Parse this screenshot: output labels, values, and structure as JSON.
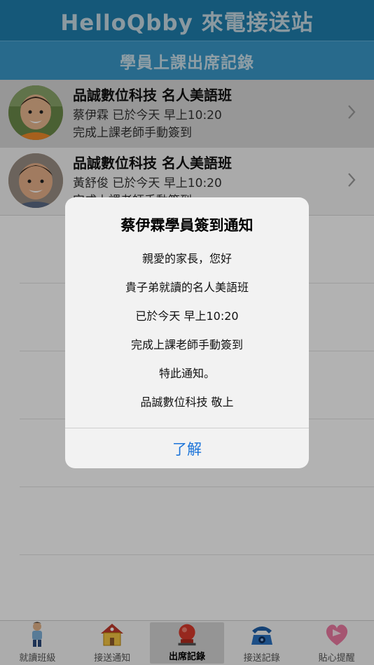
{
  "header": {
    "title": "HelloQbby 來電接送站"
  },
  "subheader": {
    "title": "學員上課出席記錄"
  },
  "records": [
    {
      "title": "品誠數位科技 名人美語班",
      "line2": "蔡伊霖 已於今天 早上10:20",
      "line3": "完成上課老師手動簽到"
    },
    {
      "title": "品誠數位科技 名人美語班",
      "line2": "黃舒俊 已於今天 早上10:20",
      "line3": "完成上課老師手動簽到"
    }
  ],
  "alert": {
    "title": "蔡伊霖學員簽到通知",
    "lines": [
      "親愛的家長，您好",
      "貴子弟就讀的名人美語班",
      "已於今天 早上10:20",
      "完成上課老師手動簽到",
      "特此通知。",
      "品誠數位科技 敬上"
    ],
    "button": "了解",
    "button_color": "#1a73d9"
  },
  "tabs": [
    {
      "label": "就讀班級",
      "icon": "student-icon"
    },
    {
      "label": "接送通知",
      "icon": "school-house-icon"
    },
    {
      "label": "出席記錄",
      "icon": "alarm-bell-icon",
      "active": true
    },
    {
      "label": "接送記錄",
      "icon": "telephone-icon"
    },
    {
      "label": "貼心提醒",
      "icon": "heart-icon"
    }
  ],
  "colors": {
    "header": "#1f7fae",
    "subheader": "#3a98c9"
  }
}
